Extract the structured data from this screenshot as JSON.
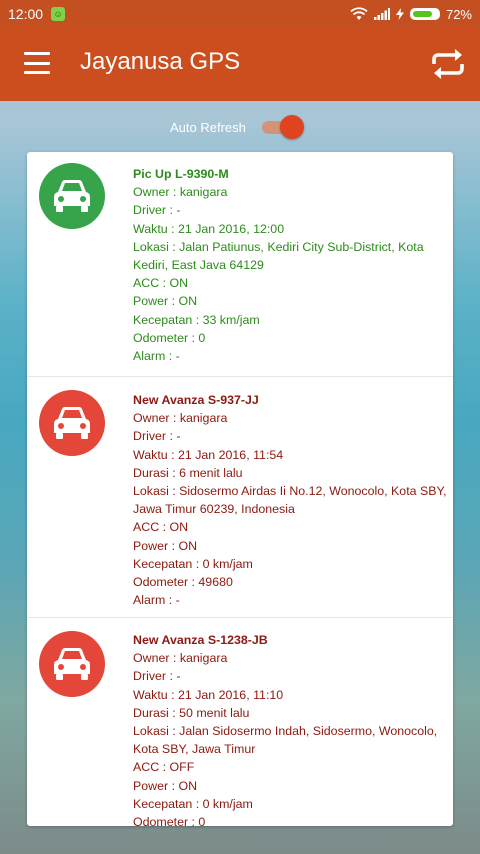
{
  "status_bar": {
    "time": "12:00",
    "battery_pct": "72%",
    "battery_level": 0.72,
    "icons": [
      "app-notification-icon",
      "wifi-icon",
      "signal-icon",
      "charging-icon",
      "battery-icon"
    ]
  },
  "app_bar": {
    "title": "Jayanusa GPS",
    "menu_icon": "hamburger-menu-icon",
    "refresh_icon": "refresh-icon",
    "color": "#cc4e1e"
  },
  "auto_refresh": {
    "label": "Auto Refresh",
    "enabled": true
  },
  "vehicles": [
    {
      "status": "green",
      "name": "Pic Up L-9390-M",
      "owner": "Owner : kanigara",
      "driver": "Driver : -",
      "waktu": "Waktu : 21 Jan 2016, 12:00",
      "lokasi": "Lokasi : Jalan Patiunus, Kediri City Sub-District, Kota Kediri, East Java 64129",
      "acc": "ACC : ON",
      "power": "Power : ON",
      "kecepatan": "Kecepatan : 33 km/jam",
      "odometer": "Odometer : 0",
      "alarm": "Alarm : -"
    },
    {
      "status": "red",
      "name": "New Avanza S-937-JJ",
      "owner": "Owner : kanigara",
      "driver": "Driver : -",
      "waktu": "Waktu : 21 Jan 2016, 11:54",
      "durasi": "Durasi : 6 menit lalu",
      "lokasi": "Lokasi : Sidosermo Airdas Ii No.12, Wonocolo, Kota SBY, Jawa Timur 60239, Indonesia",
      "acc": "ACC : ON",
      "power": "Power : ON",
      "kecepatan": "Kecepatan : 0 km/jam",
      "odometer": "Odometer : 49680",
      "alarm": "Alarm : -"
    },
    {
      "status": "red",
      "name": "New Avanza S-1238-JB",
      "owner": "Owner : kanigara",
      "driver": "Driver : -",
      "waktu": "Waktu : 21 Jan 2016, 11:10",
      "durasi": "Durasi : 50 menit lalu",
      "lokasi": "Lokasi : Jalan Sidosermo Indah, Sidosermo, Wonocolo, Kota SBY, Jawa Timur",
      "acc": "ACC : OFF",
      "power": "Power : ON",
      "kecepatan": "Kecepatan : 0 km/jam",
      "odometer": "Odometer : 0"
    }
  ],
  "colors": {
    "green_status": "#37a34a",
    "red_status": "#e4473a",
    "green_text": "#2e8b1c",
    "red_text": "#8b1a10"
  }
}
